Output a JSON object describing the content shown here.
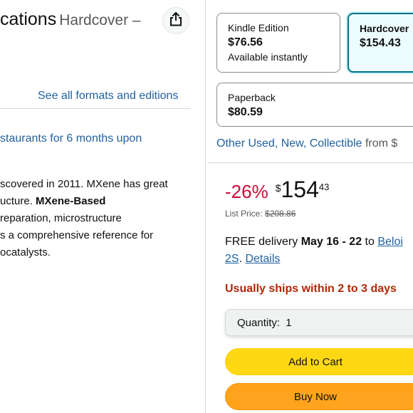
{
  "product": {
    "title_fragment": "cations",
    "format_suffix": "Hardcover –",
    "see_all": "See all formats and editions",
    "promo_fragment": "staurants for 6 months upon",
    "description": {
      "line1": "scovered in 2011. MXene has great",
      "line2_pre": "ucture. ",
      "line2_bold": "MXene-Based",
      "line3": "reparation, microstructure",
      "line4": "s a comprehensive reference for",
      "line5": "ocatalysts."
    }
  },
  "formats": [
    {
      "name": "Kindle Edition",
      "price": "$76.56",
      "sub": "Available instantly"
    },
    {
      "name": "Hardcover",
      "price": "$154.43"
    },
    {
      "name": "Paperback",
      "price": "$80.59"
    }
  ],
  "other_used": {
    "link": "Other Used, New, Collectible",
    "from": "from $"
  },
  "buybox": {
    "discount": "-26%",
    "currency": "$",
    "price_whole": "154",
    "price_fraction": "43",
    "list_price_label": "List Price:",
    "list_price": "$208.86",
    "delivery_prefix": "FREE delivery",
    "delivery_dates": "May 16 - 22",
    "delivery_to": "to",
    "delivery_location": "Beloi",
    "delivery_location_2": "2S",
    "delivery_details": "Details",
    "ships": "Usually ships within 2 to 3 days",
    "quantity_label": "Quantity:",
    "quantity_value": "1",
    "add_to_cart": "Add to Cart",
    "buy_now": "Buy Now"
  },
  "colors": {
    "accent_link": "#2162a1",
    "discount_red": "#cc0c39",
    "ships_red": "#b12704",
    "add_to_cart_yellow": "#ffd814",
    "buy_now_orange": "#ffa41c",
    "selected_border": "#007185"
  },
  "icons": {
    "share": "share-icon"
  }
}
